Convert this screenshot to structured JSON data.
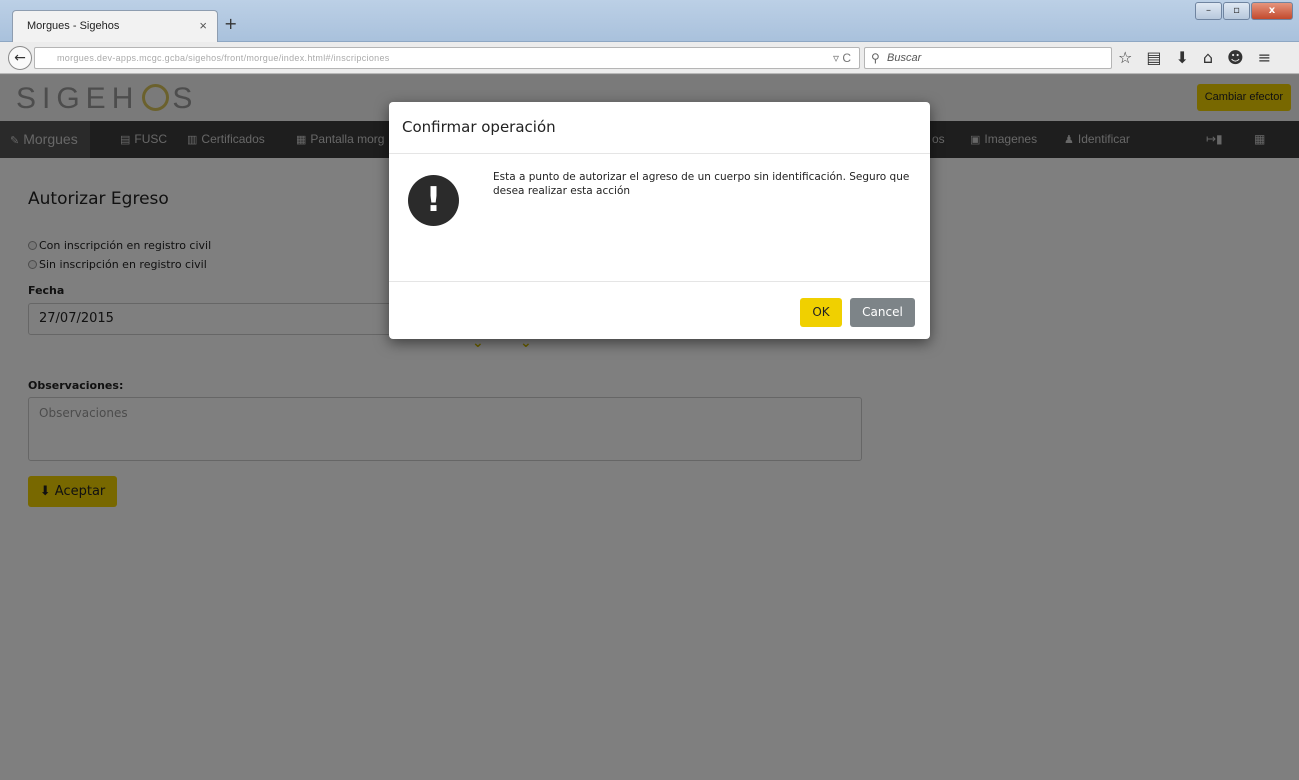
{
  "browser": {
    "tab_title": "Morgues - Sigehos",
    "tab_close": "×",
    "new_tab": "+",
    "url": "morgues.dev-apps.mcgc.gcba/sigehos/front/morgue/index.html#/inscripciones",
    "url_reader": "▿",
    "url_reload": "C",
    "search_placeholder": "Buscar",
    "window_buttons": {
      "minimize": "–",
      "maximize": "▫",
      "close": "x"
    },
    "toolbar": {
      "bookmark": "☆",
      "reading": "▤",
      "download": "⬇",
      "home": "⌂",
      "chat": "☻",
      "menu": "≡"
    }
  },
  "app": {
    "logo_left": "SIGEH",
    "logo_right": "S",
    "change_button": "Cambiar efector",
    "menu": [
      {
        "icon": "tag-icon",
        "glyph": "✎",
        "label": "Morgues"
      },
      {
        "icon": "file-icon",
        "glyph": "▤",
        "label": "FUSC"
      },
      {
        "icon": "certificate-icon",
        "glyph": "▥",
        "label": "Certificados"
      },
      {
        "icon": "screen-icon",
        "glyph": "▦",
        "label": "Pantalla morg"
      },
      {
        "icon": "folder-icon",
        "glyph": "",
        "label": "os"
      },
      {
        "icon": "image-icon",
        "glyph": "▣",
        "label": "Imagenes"
      },
      {
        "icon": "user-icon",
        "glyph": "♟",
        "label": "Identificar"
      }
    ],
    "menu_right": {
      "exit": "↦▮",
      "grid": "▦"
    }
  },
  "form": {
    "title": "Autorizar Egreso",
    "radio_with": "Con inscripción en registro civil",
    "radio_without": "Sin inscripción en registro civil",
    "date_label": "Fecha",
    "date_value": "27/07/2015",
    "obs_label": "Observaciones:",
    "obs_placeholder": "Observaciones",
    "accept_button": "Aceptar",
    "accept_icon": "⬇"
  },
  "modal": {
    "title": "Confirmar operación",
    "icon": "!",
    "message": "Esta a punto de autorizar el agreso de un cuerpo sin identificación. Seguro que desea realizar esta acción",
    "ok": "OK",
    "cancel": "Cancel"
  },
  "colors": {
    "accent_yellow": "#f0d000",
    "menu_bg": "#3c3c3c",
    "cancel_gray": "#7d8488"
  }
}
